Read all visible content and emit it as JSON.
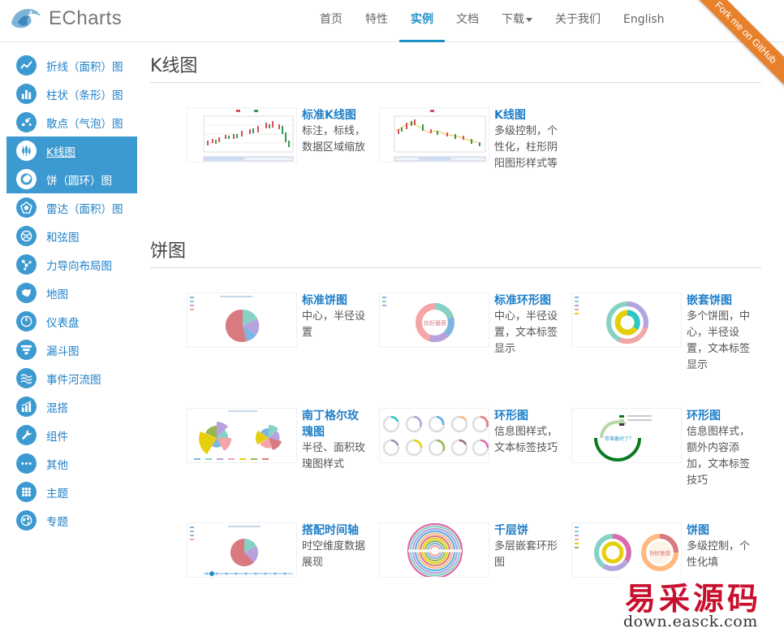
{
  "brand": {
    "name": "ECharts"
  },
  "nav": {
    "items": [
      {
        "label": "首页"
      },
      {
        "label": "特性"
      },
      {
        "label": "实例"
      },
      {
        "label": "文档"
      },
      {
        "label": "下载"
      },
      {
        "label": "关于我们"
      },
      {
        "label": "English"
      }
    ],
    "active": "实例"
  },
  "ribbon": {
    "label": "Fork me on GitHub"
  },
  "sidebar": {
    "items": [
      {
        "label": "折线（面积）图",
        "icon": "line-chart-icon"
      },
      {
        "label": "柱状（条形）图",
        "icon": "bar-chart-icon"
      },
      {
        "label": "散点（气泡）图",
        "icon": "scatter-chart-icon"
      },
      {
        "label": "K线图",
        "icon": "candlestick-icon",
        "active": true
      },
      {
        "label": "饼（圆环）图",
        "icon": "pie-chart-icon",
        "active": true
      },
      {
        "label": "雷达（面积）图",
        "icon": "radar-chart-icon"
      },
      {
        "label": "和弦图",
        "icon": "chord-chart-icon"
      },
      {
        "label": "力导向布局图",
        "icon": "force-graph-icon"
      },
      {
        "label": "地图",
        "icon": "map-icon"
      },
      {
        "label": "仪表盘",
        "icon": "gauge-icon"
      },
      {
        "label": "漏斗图",
        "icon": "funnel-icon"
      },
      {
        "label": "事件河流图",
        "icon": "event-river-icon"
      },
      {
        "label": "混搭",
        "icon": "mixed-chart-icon"
      },
      {
        "label": "组件",
        "icon": "wrench-icon"
      },
      {
        "label": "其他",
        "icon": "more-icon"
      },
      {
        "label": "主题",
        "icon": "theme-icon"
      },
      {
        "label": "专题",
        "icon": "globe-icon"
      }
    ]
  },
  "sections": [
    {
      "title": "K线图",
      "cards": [
        {
          "title": "标准K线图",
          "desc": "标注，标线，数据区域缩放",
          "thumb": "candlestick-standard"
        },
        {
          "title": "K线图",
          "desc": "多级控制，个性化，柱形阴阳图形样式等",
          "thumb": "candlestick-custom"
        }
      ]
    },
    {
      "title": "饼图",
      "cards": [
        {
          "title": "标准饼图",
          "desc": "中心，半径设置",
          "thumb": "pie-standard"
        },
        {
          "title": "标准环形图",
          "desc": "中心，半径设置，文本标签显示",
          "thumb": "donut-standard"
        },
        {
          "title": "嵌套饼图",
          "desc": "多个饼图，中心，半径设置，文本标签显示",
          "thumb": "pie-nested"
        },
        {
          "title": "南丁格尔玫瑰图",
          "desc": "半径、面积玫瑰图样式",
          "thumb": "nightingale-rose"
        },
        {
          "title": "环形图",
          "desc": "信息图样式，文本标签技巧",
          "thumb": "donut-infographic"
        },
        {
          "title": "环形图",
          "desc": "信息图样式，额外内容添加，文本标签技巧",
          "thumb": "donut-ring-extra"
        },
        {
          "title": "搭配时间轴",
          "desc": "时空维度数据展现",
          "thumb": "pie-timeline"
        },
        {
          "title": "千层饼",
          "desc": "多层嵌套环形图",
          "thumb": "pie-multilayer"
        },
        {
          "title": "饼图",
          "desc": "多级控制，个性化填",
          "thumb": "pie-custom"
        }
      ]
    }
  ],
  "thumb_text": {
    "donut_center": "你好雅蓉",
    "ring_question": "你准备好了？",
    "custom_label": "你好雅蓉"
  },
  "watermark": {
    "cn": "易采源码",
    "url": "down.easck.com"
  },
  "colors": {
    "accent": "#1e7fc8",
    "sidebar_active": "#3d9ad1",
    "ribbon": "#e8812c",
    "watermark_red": "#c8102e"
  }
}
